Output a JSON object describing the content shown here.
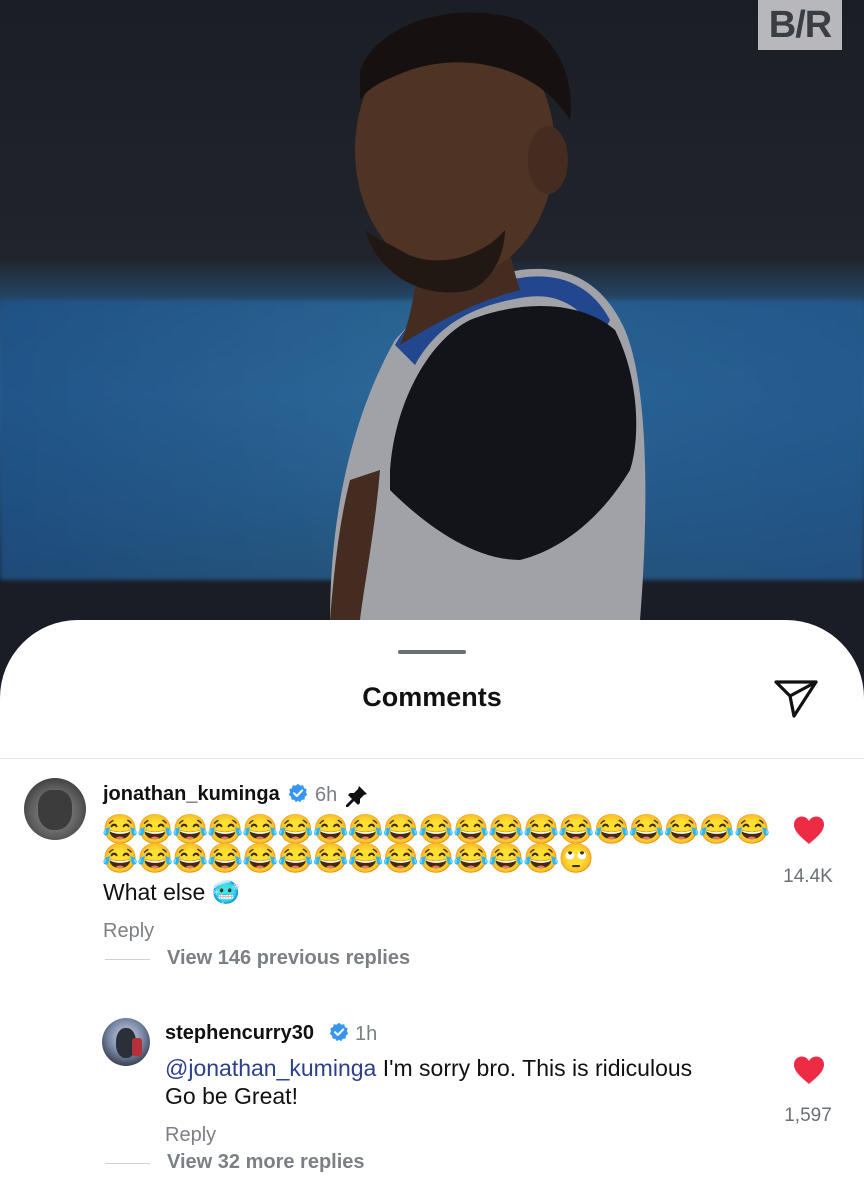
{
  "overlay": {
    "logo_text": "B/R"
  },
  "sheet": {
    "title": "Comments"
  },
  "comments": [
    {
      "username": "jonathan_kuminga",
      "verified": true,
      "time": "6h",
      "pinned": true,
      "emoji_line_1": "😂😂😂😂😂😂😂😂😂😂😂😂😂😂😂😂😂😂😂",
      "emoji_line_2": "😂😂😂😂😂😂😂😂😂😂😂😂😂🙄",
      "text": "What else 🥶",
      "reply_label": "Reply",
      "view_replies_label": "View 146 previous replies",
      "likes": "14.4K",
      "liked": true
    },
    {
      "username": "stephencurry30",
      "verified": true,
      "time": "1h",
      "mention": "@jonathan_kuminga",
      "text_line_1": " I'm sorry bro. This is ridiculous",
      "text_line_2": "Go be Great!",
      "reply_label": "Reply",
      "view_replies_label": "View 32 more replies",
      "likes": "1,597",
      "liked": true
    }
  ],
  "colors": {
    "heart_red": "#ed2b45",
    "verified_blue": "#3797f0",
    "mention_blue": "#2b3f8f",
    "muted_text": "#7b7f86"
  },
  "icons": {
    "send": "paper-plane-icon",
    "heart": "heart-filled-icon",
    "verified": "verified-badge-icon",
    "pin": "pin-icon"
  }
}
